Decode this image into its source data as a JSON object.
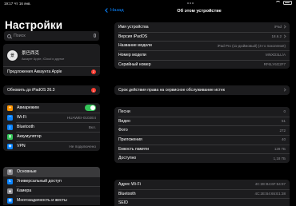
{
  "status": {
    "time": "19:17",
    "date": "Чт 16 янв."
  },
  "left": {
    "title": "Настройки",
    "search": {
      "placeholder": "Поиск"
    },
    "profile": {
      "avatar_text": "景",
      "name": "景巴西克",
      "subtitle": "Аккаунт Apple, iCloud и другое"
    },
    "account_suggestion": {
      "label": "Предложения Аккаунта Apple",
      "badge": "2"
    },
    "update": {
      "label": "Обновить до iPadOS 26.3",
      "badge": "1"
    },
    "connectivity": [
      {
        "label": "Авиарежим",
        "value": "",
        "icon": "airplane-icon",
        "color": "#ff9500",
        "glyph": "✈"
      },
      {
        "label": "Wi-Fi",
        "value": "HUAWEI-0102E4",
        "icon": "wifi-icon",
        "color": "#0a84ff",
        "glyph": "◠"
      },
      {
        "label": "Bluetooth",
        "value": "Вкл.",
        "icon": "bluetooth-icon",
        "color": "#0a84ff",
        "glyph": "ᛒ"
      },
      {
        "label": "Аккумулятор",
        "value": "",
        "icon": "battery-icon",
        "color": "#34c759",
        "glyph": "▮"
      },
      {
        "label": "VPN",
        "value": "Не подключено",
        "icon": "vpn-icon",
        "color": "#0a84ff",
        "glyph": "◉"
      }
    ],
    "general": [
      {
        "label": "Основные",
        "icon": "gear-icon",
        "color": "#8e8e93",
        "glyph": "⚙"
      },
      {
        "label": "Универсальный доступ",
        "icon": "accessibility-icon",
        "color": "#0a84ff",
        "glyph": "♿"
      },
      {
        "label": "Камера",
        "icon": "camera-icon",
        "color": "#8e8e93",
        "glyph": "◙"
      },
      {
        "label": "Многозадачность и жесты",
        "icon": "multitasking-icon",
        "color": "#0a84ff",
        "glyph": "▦"
      }
    ]
  },
  "right": {
    "back_label": "Назад",
    "title": "Об этом устройстве",
    "info": [
      {
        "label": "Имя устройства",
        "value": "iPad"
      },
      {
        "label": "Версия iPadOS",
        "value": "18.6.2"
      },
      {
        "label": "Название модели",
        "value": "iPad Pro (11-дюймовый) (4-го поколения)"
      },
      {
        "label": "Номер модели",
        "value": "MNXD3LL/A"
      },
      {
        "label": "Серийный номер",
        "value": "RF6LY6G2F7"
      }
    ],
    "service": {
      "label": "Срок действия права на сервисное обслуживание истек"
    },
    "media": [
      {
        "label": "Песни",
        "value": "0"
      },
      {
        "label": "Видео",
        "value": "51"
      },
      {
        "label": "Фото",
        "value": "272"
      },
      {
        "label": "Приложения",
        "value": "40"
      },
      {
        "label": "Емкость памяти",
        "value": "128 ГБ"
      },
      {
        "label": "Доступно",
        "value": "1,18 ГБ"
      }
    ],
    "network": [
      {
        "label": "Адрес Wi-Fi",
        "value": "4C:2E:B4:6F:54:97"
      },
      {
        "label": "Bluetooth",
        "value": "4C:2E:B4:65:E1:38"
      },
      {
        "label": "SEID",
        "value": ""
      }
    ]
  }
}
